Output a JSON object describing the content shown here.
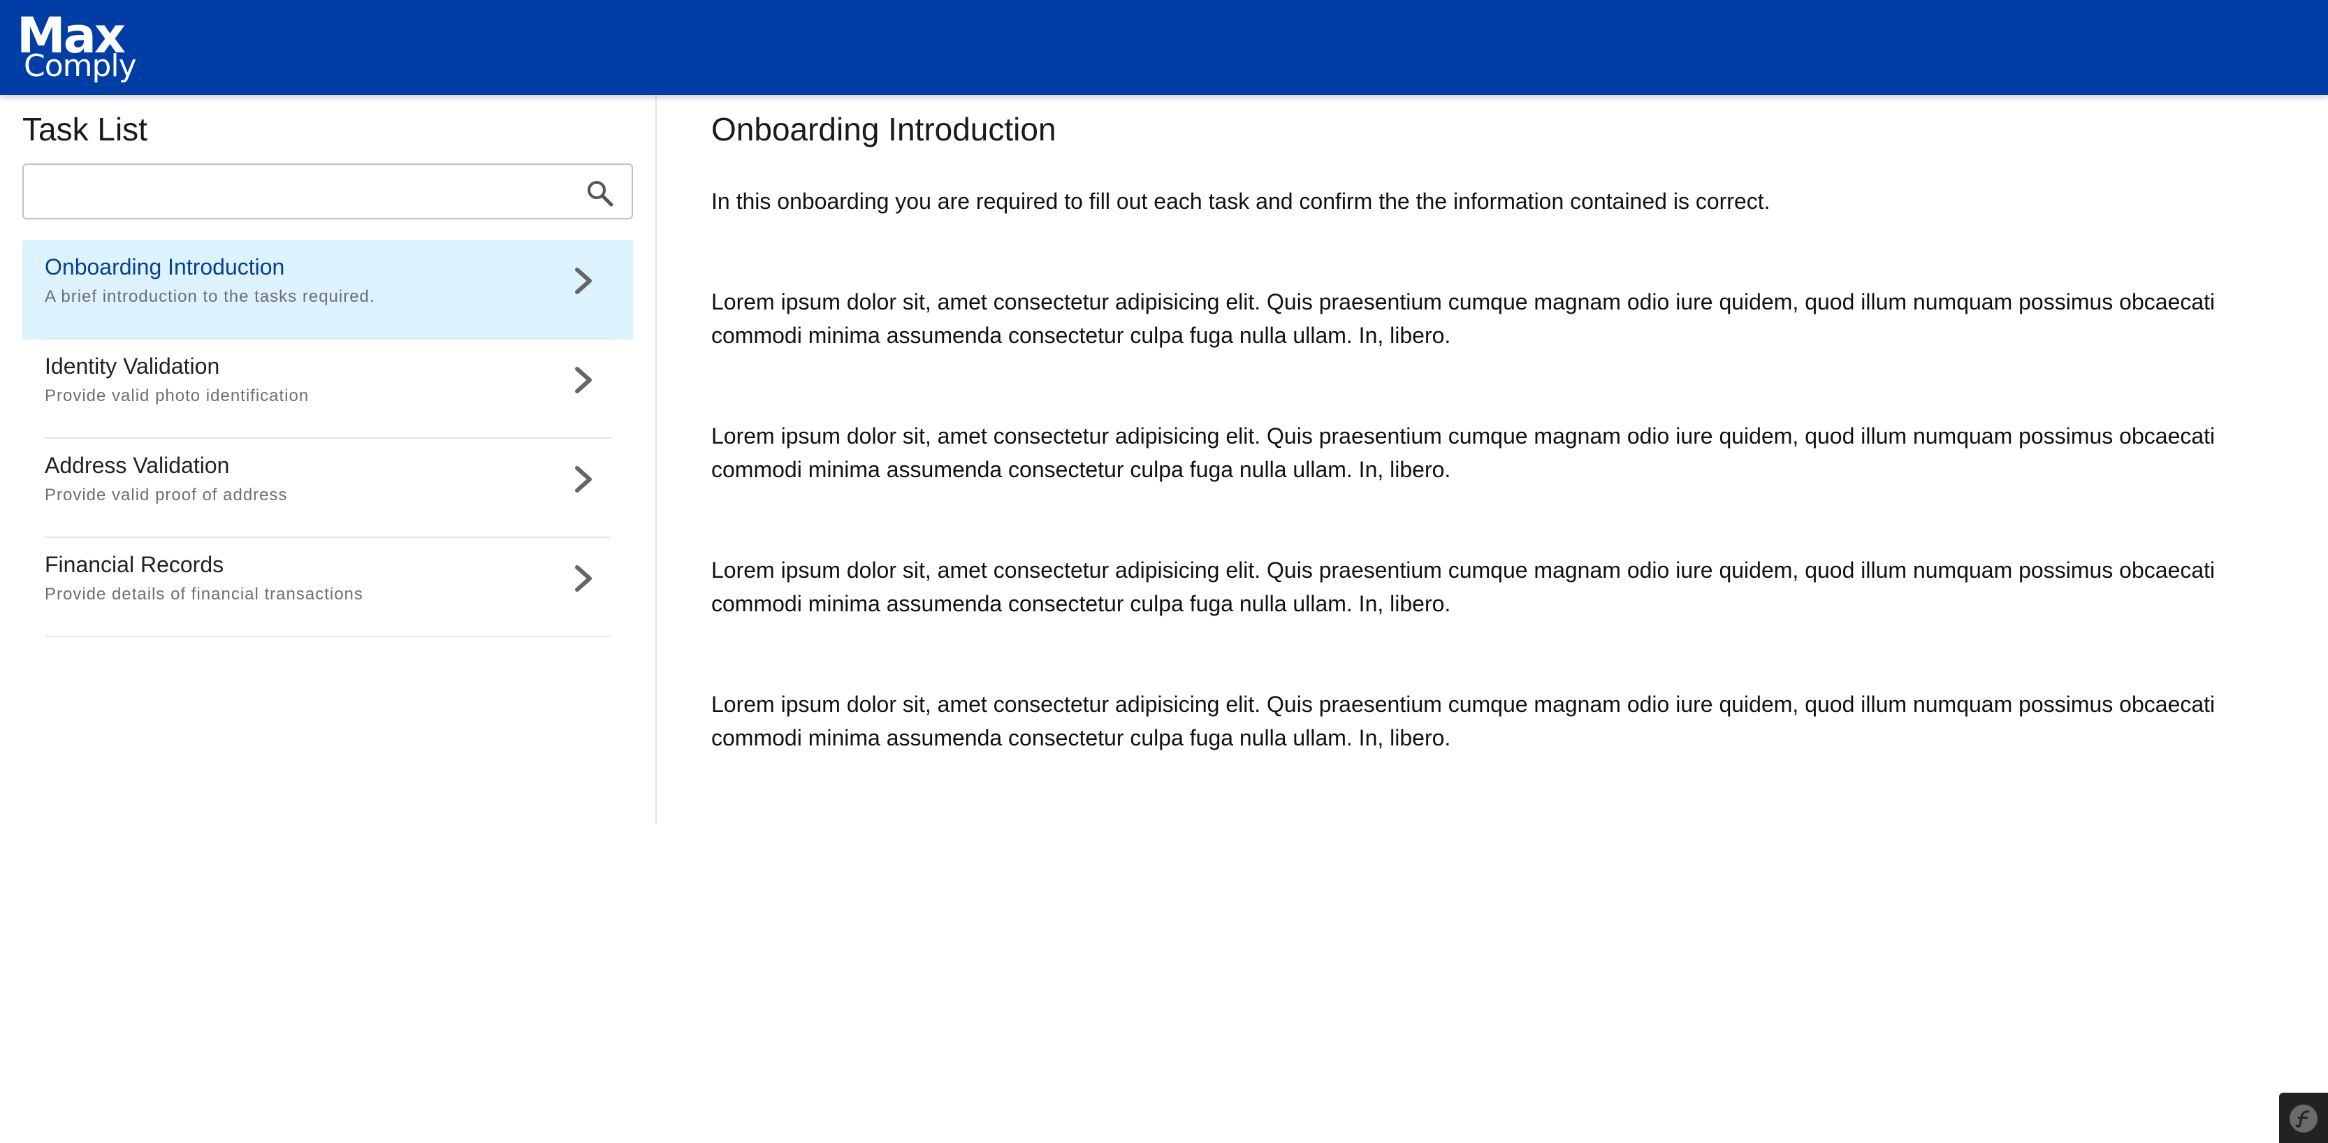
{
  "header": {
    "logo_line1": "Max",
    "logo_line2": "Comply",
    "background": "#003da5"
  },
  "sidebar": {
    "title": "Task List",
    "search": {
      "placeholder": "",
      "value": "",
      "icon": "search-icon"
    },
    "items": [
      {
        "title": "Onboarding Introduction",
        "subtitle": "A brief introduction to the tasks required.",
        "active": true,
        "icon": "chevron-right-icon"
      },
      {
        "title": "Identity Validation",
        "subtitle": "Provide valid photo identification",
        "active": false,
        "icon": "chevron-right-icon"
      },
      {
        "title": "Address Validation",
        "subtitle": "Provide valid proof of address",
        "active": false,
        "icon": "chevron-right-icon"
      },
      {
        "title": "Financial Records",
        "subtitle": "Provide details of financial transactions",
        "active": false,
        "icon": "chevron-right-icon"
      }
    ],
    "active_background": "#dcf3fd",
    "active_text_color": "#0a3f8f"
  },
  "main": {
    "title": "Onboarding Introduction",
    "intro": "In this onboarding you are required to fill out each task and confirm the the information contained is correct.",
    "paragraphs": [
      "Lorem ipsum dolor sit, amet consectetur adipisicing elit. Quis praesentium cumque magnam odio iure quidem, quod illum numquam possimus obcaecati commodi minima assumenda consectetur culpa fuga nulla ullam. In, libero.",
      "Lorem ipsum dolor sit, amet consectetur adipisicing elit. Quis praesentium cumque magnam odio iure quidem, quod illum numquam possimus obcaecati commodi minima assumenda consectetur culpa fuga nulla ullam. In, libero.",
      "Lorem ipsum dolor sit, amet consectetur adipisicing elit. Quis praesentium cumque magnam odio iure quidem, quod illum numquam possimus obcaecati commodi minima assumenda consectetur culpa fuga nulla ullam. In, libero.",
      "Lorem ipsum dolor sit, amet consectetur adipisicing elit. Quis praesentium cumque magnam odio iure quidem, quod illum numquam possimus obcaecati commodi minima assumenda consectetur culpa fuga nulla ullam. In, libero."
    ]
  },
  "debug_toolbar": {
    "icon": "symfony-icon"
  }
}
